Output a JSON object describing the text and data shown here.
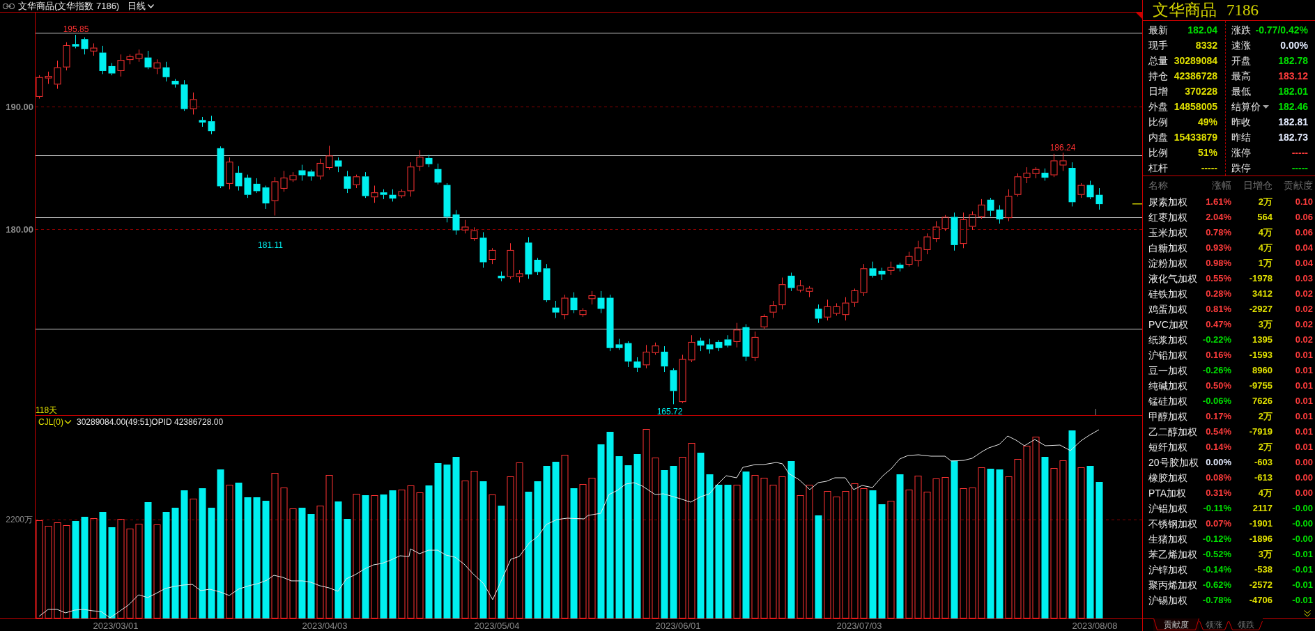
{
  "header": {
    "title": "文华商品(文华指数 7186)",
    "period": "日线"
  },
  "price_chart": {
    "axis_labels": [
      "190.00",
      "180.00"
    ],
    "extreme_labels": [
      {
        "text": "195.85",
        "kind": "high"
      },
      {
        "text": "181.11",
        "kind": "low"
      },
      {
        "text": "165.72",
        "kind": "low"
      },
      {
        "text": "186.24",
        "kind": "high"
      }
    ],
    "day_count": "118天"
  },
  "volume_chart": {
    "indicator": "CJL(0)",
    "volume": "30289084.00(49:51)",
    "open_interest": "OPID 42386728.00",
    "axis_label": "2200万"
  },
  "date_axis": {
    "labels": [
      "2023/03/01",
      "2023/04/03",
      "2023/05/04",
      "2023/06/01",
      "2023/07/03",
      "2023/08/08"
    ]
  },
  "quote_panel": {
    "name": "文华商品",
    "code": "7186",
    "columns": [
      {
        "fields": [
          {
            "label": "最新",
            "value": "182.04",
            "color": "#00e000",
            "dropdown": false
          },
          {
            "label": "现手",
            "value": "8332",
            "color": "#e0e000",
            "dropdown": false
          },
          {
            "label": "总量",
            "value": "30289084",
            "color": "#e0e000",
            "dropdown": false
          },
          {
            "label": "持仓",
            "value": "42386728",
            "color": "#e0e000",
            "dropdown": false
          },
          {
            "label": "日增",
            "value": "370228",
            "color": "#e0e000",
            "dropdown": false
          },
          {
            "label": "外盘",
            "value": "14858005",
            "color": "#e0e000",
            "dropdown": false
          },
          {
            "label": "比例",
            "value": "49%",
            "color": "#e0e000",
            "dropdown": false
          },
          {
            "label": "内盘",
            "value": "15433879",
            "color": "#e0e000",
            "dropdown": false
          },
          {
            "label": "比例",
            "value": "51%",
            "color": "#e0e000",
            "dropdown": false
          },
          {
            "label": "杠杆",
            "value": "-----",
            "color": "#e0e000",
            "dropdown": false
          }
        ]
      },
      {
        "fields": [
          {
            "label": "涨跌",
            "value": "-0.77/0.42%",
            "color": "#00e000",
            "dropdown": false
          },
          {
            "label": "速涨",
            "value": "0.00%",
            "color": "#e4ecff",
            "dropdown": false
          },
          {
            "label": "开盘",
            "value": "182.78",
            "color": "#00e000",
            "dropdown": false
          },
          {
            "label": "最高",
            "value": "183.12",
            "color": "#ff3c3c",
            "dropdown": false
          },
          {
            "label": "最低",
            "value": "182.01",
            "color": "#00e000",
            "dropdown": false
          },
          {
            "label": "结算价",
            "value": "182.46",
            "color": "#00e000",
            "dropdown": true
          },
          {
            "label": "昨收",
            "value": "182.81",
            "color": "#e4ecff",
            "dropdown": false
          },
          {
            "label": "昨结",
            "value": "182.73",
            "color": "#e4ecff",
            "dropdown": false
          },
          {
            "label": "涨停",
            "value": "-----",
            "color": "#ff3c3c",
            "dropdown": false
          },
          {
            "label": "跌停",
            "value": "-----",
            "color": "#00e000",
            "dropdown": false
          }
        ]
      }
    ]
  },
  "table": {
    "columns": [
      "名称",
      "涨幅",
      "日增仓",
      "贡献度"
    ],
    "rows": [
      {
        "name": "尿素加权",
        "change": {
          "text": "1.61%",
          "color": "#ff3c3c"
        },
        "oi_change": "2万",
        "contribution": {
          "text": "0.10",
          "color": "#ff3c3c"
        }
      },
      {
        "name": "红枣加权",
        "change": {
          "text": "2.04%",
          "color": "#ff3c3c"
        },
        "oi_change": "564",
        "contribution": {
          "text": "0.06",
          "color": "#ff3c3c"
        }
      },
      {
        "name": "玉米加权",
        "change": {
          "text": "0.78%",
          "color": "#ff3c3c"
        },
        "oi_change": "4万",
        "contribution": {
          "text": "0.06",
          "color": "#ff3c3c"
        }
      },
      {
        "name": "白糖加权",
        "change": {
          "text": "0.93%",
          "color": "#ff3c3c"
        },
        "oi_change": "4万",
        "contribution": {
          "text": "0.04",
          "color": "#ff3c3c"
        }
      },
      {
        "name": "淀粉加权",
        "change": {
          "text": "0.98%",
          "color": "#ff3c3c"
        },
        "oi_change": "1万",
        "contribution": {
          "text": "0.04",
          "color": "#ff3c3c"
        }
      },
      {
        "name": "液化气加权",
        "change": {
          "text": "0.55%",
          "color": "#ff3c3c"
        },
        "oi_change": "-1978",
        "contribution": {
          "text": "0.03",
          "color": "#ff3c3c"
        }
      },
      {
        "name": "硅铁加权",
        "change": {
          "text": "0.28%",
          "color": "#ff3c3c"
        },
        "oi_change": "3412",
        "contribution": {
          "text": "0.02",
          "color": "#ff3c3c"
        }
      },
      {
        "name": "鸡蛋加权",
        "change": {
          "text": "0.81%",
          "color": "#ff3c3c"
        },
        "oi_change": "-2927",
        "contribution": {
          "text": "0.02",
          "color": "#ff3c3c"
        }
      },
      {
        "name": "PVC加权",
        "change": {
          "text": "0.47%",
          "color": "#ff3c3c"
        },
        "oi_change": "3万",
        "contribution": {
          "text": "0.02",
          "color": "#ff3c3c"
        }
      },
      {
        "name": "纸浆加权",
        "change": {
          "text": "-0.22%",
          "color": "#00e000"
        },
        "oi_change": "1395",
        "contribution": {
          "text": "0.02",
          "color": "#ff3c3c"
        }
      },
      {
        "name": "沪铅加权",
        "change": {
          "text": "0.16%",
          "color": "#ff3c3c"
        },
        "oi_change": "-1593",
        "contribution": {
          "text": "0.01",
          "color": "#ff3c3c"
        }
      },
      {
        "name": "豆一加权",
        "change": {
          "text": "-0.26%",
          "color": "#00e000"
        },
        "oi_change": "8960",
        "contribution": {
          "text": "0.01",
          "color": "#ff3c3c"
        }
      },
      {
        "name": "纯碱加权",
        "change": {
          "text": "0.50%",
          "color": "#ff3c3c"
        },
        "oi_change": "-9755",
        "contribution": {
          "text": "0.01",
          "color": "#ff3c3c"
        }
      },
      {
        "name": "锰硅加权",
        "change": {
          "text": "-0.06%",
          "color": "#00e000"
        },
        "oi_change": "7626",
        "contribution": {
          "text": "0.01",
          "color": "#ff3c3c"
        }
      },
      {
        "name": "甲醇加权",
        "change": {
          "text": "0.17%",
          "color": "#ff3c3c"
        },
        "oi_change": "2万",
        "contribution": {
          "text": "0.01",
          "color": "#ff3c3c"
        }
      },
      {
        "name": "乙二醇加权",
        "change": {
          "text": "0.54%",
          "color": "#ff3c3c"
        },
        "oi_change": "-7919",
        "contribution": {
          "text": "0.01",
          "color": "#ff3c3c"
        }
      },
      {
        "name": "短纤加权",
        "change": {
          "text": "0.14%",
          "color": "#ff3c3c"
        },
        "oi_change": "2万",
        "contribution": {
          "text": "0.01",
          "color": "#ff3c3c"
        }
      },
      {
        "name": "20号胶加权",
        "change": {
          "text": "0.00%",
          "color": "#e4ecff"
        },
        "oi_change": "-603",
        "contribution": {
          "text": "0.00",
          "color": "#ff3c3c"
        }
      },
      {
        "name": "橡胶加权",
        "change": {
          "text": "0.08%",
          "color": "#ff3c3c"
        },
        "oi_change": "-613",
        "contribution": {
          "text": "0.00",
          "color": "#ff3c3c"
        }
      },
      {
        "name": "PTA加权",
        "change": {
          "text": "0.31%",
          "color": "#ff3c3c"
        },
        "oi_change": "4万",
        "contribution": {
          "text": "0.00",
          "color": "#ff3c3c"
        }
      },
      {
        "name": "沪铝加权",
        "change": {
          "text": "-0.11%",
          "color": "#00e000"
        },
        "oi_change": "2117",
        "contribution": {
          "text": "-0.00",
          "color": "#00e000"
        }
      },
      {
        "name": "不锈钢加权",
        "change": {
          "text": "0.07%",
          "color": "#ff3c3c"
        },
        "oi_change": "-1901",
        "contribution": {
          "text": "-0.00",
          "color": "#00e000"
        }
      },
      {
        "name": "生猪加权",
        "change": {
          "text": "-0.12%",
          "color": "#00e000"
        },
        "oi_change": "-1896",
        "contribution": {
          "text": "-0.00",
          "color": "#00e000"
        }
      },
      {
        "name": "苯乙烯加权",
        "change": {
          "text": "-0.52%",
          "color": "#00e000"
        },
        "oi_change": "3万",
        "contribution": {
          "text": "-0.01",
          "color": "#00e000"
        }
      },
      {
        "name": "沪锌加权",
        "change": {
          "text": "-0.14%",
          "color": "#00e000"
        },
        "oi_change": "-538",
        "contribution": {
          "text": "-0.01",
          "color": "#00e000"
        }
      },
      {
        "name": "聚丙烯加权",
        "change": {
          "text": "-0.62%",
          "color": "#00e000"
        },
        "oi_change": "-2572",
        "contribution": {
          "text": "-0.01",
          "color": "#00e000"
        }
      },
      {
        "name": "沪锡加权",
        "change": {
          "text": "-0.78%",
          "color": "#00e000"
        },
        "oi_change": "-4706",
        "contribution": {
          "text": "-0.01",
          "color": "#00e000"
        }
      }
    ]
  },
  "tabs": [
    {
      "label": "贡献度",
      "selected": true
    },
    {
      "label": "领涨",
      "selected": false
    },
    {
      "label": "领跌",
      "selected": false
    }
  ]
}
